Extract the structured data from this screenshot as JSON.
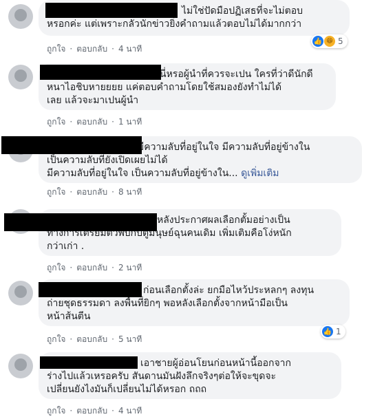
{
  "colors": {
    "bubble": "#f2f3f5",
    "link": "#385898",
    "meta": "#606770",
    "like": "#1877f2",
    "haha": "#f7b125"
  },
  "action_labels": {
    "like": "ถูกใจ",
    "reply": "ตอบกลับ",
    "dot": "·"
  },
  "comments": [
    {
      "lines": [
        "ไม่ใช่ปัดมือปฏิเสธที่จะไม่ตอบ",
        "หรอกค่ะ แต่เพราะกลัวนักข่าวยิ่งคำถามแล้วตอบไม่ได้มากกว่า"
      ],
      "time": "4 นาที",
      "reaction": {
        "icons": [
          "like-icon",
          "haha-icon"
        ],
        "count": "5"
      }
    },
    {
      "lines": [
        "นี่หรอผู้นำที่ควรจะเปน ใครที่ว่าดีนักดี",
        "หนาไอชิบหายยยย แค่ตอบคำถามโดยใช้สมองยังทำไม่ได้",
        "เลย แล้วจะมาเปนผู้นำ"
      ],
      "time": "1 นาที"
    },
    {
      "lines": [
        "มีความลับที่อยู่ในใจ มีความลับที่อยู่ข้างใน",
        "เป็นความลับที่ยังเปิดเผยไม่ได้",
        "มีความลับที่อยู่ในใจ เป็นความลับที่อยู่ข้างใน..."
      ],
      "see_more": "ดูเพิ่มเติม",
      "time": "8 นาที"
    },
    {
      "lines": [
        "หลังประกาศผลเลือกตั้มอย่างเป็น",
        "ทางการเตรียมตัวพบกับตู่มนุษย์ฉุนคนเดิม เพิ่มเติมคือโง่หนัก",
        "กว่าเก่า ."
      ],
      "time": "2 นาที"
    },
    {
      "lines": [
        "ก่อนเลือกตั้งล่ะ ยกมือไหว้ประหลกๆ ลงทุน",
        "ถ่ายชุดธรรมดา ลงพื้นที่ยิกๆ พอหลังเลือกตั้งจากหน้ามือเป็น",
        "หน้าส้นตีน"
      ],
      "time": "5 นาที",
      "reaction": {
        "icons": [
          "like-icon"
        ],
        "count": "1"
      }
    },
    {
      "lines": [
        "เอาชายผู้อ่อนโยนก่อนหน้านี้ออกจาก",
        "ร่างไปแล้วเหรอครับ สันดานมันฝังลึกจริงๆต่อให้จะขุดจะ",
        "เปลี่ยนยังไงมันก็เปลี่ยนไม่ได้หรอก ถถถ"
      ],
      "time": "4 นาที"
    }
  ]
}
